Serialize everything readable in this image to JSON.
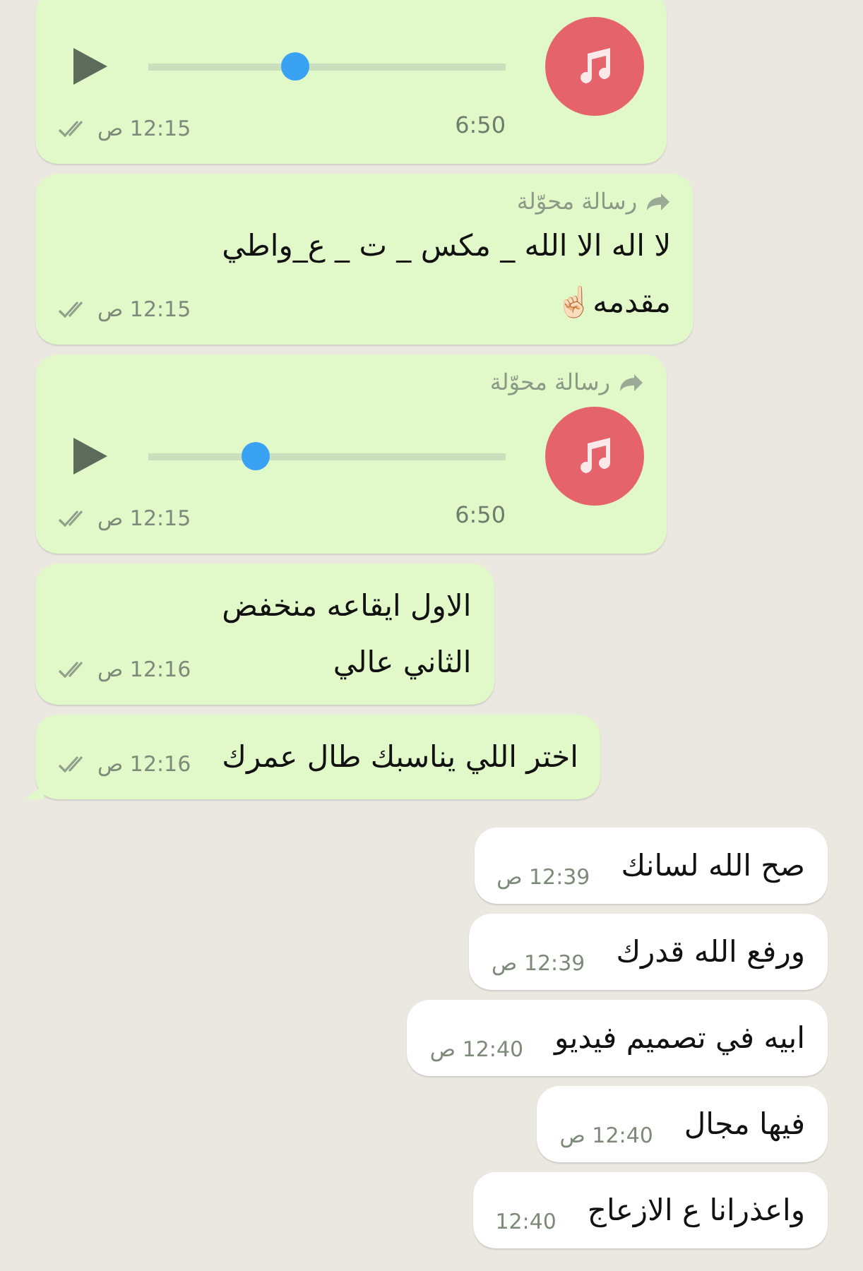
{
  "messages": [
    {
      "outgoing": true,
      "kind": "audio",
      "level": 0.41,
      "duration": "6:50",
      "time": "12:15 ص",
      "read": false,
      "tail": false
    },
    {
      "outgoing": true,
      "kind": "text",
      "forwarded_label": "رسالة محوّلة",
      "text": "لا اله الا الله _ مكس _ ت _ ع_واطي\nمقدمه☝🏻",
      "time": "12:15 ص",
      "read": false,
      "tail": false
    },
    {
      "outgoing": true,
      "kind": "audio",
      "forwarded_label": "رسالة محوّلة",
      "level": 0.3,
      "duration": "6:50",
      "time": "12:15 ص",
      "read": false,
      "tail": false
    },
    {
      "outgoing": true,
      "kind": "text",
      "text": "الاول ايقاعه منخفض\nالثاني عالي",
      "time": "12:16 ص",
      "read": false,
      "tail": false
    },
    {
      "outgoing": true,
      "kind": "text",
      "text": "اختر اللي يناسبك طال عمرك",
      "time": "12:16 ص",
      "read": false,
      "tail": true
    },
    {
      "outgoing": false,
      "kind": "text",
      "text": "صح الله لسانك",
      "time": "12:39 ص",
      "tail": false
    },
    {
      "outgoing": false,
      "kind": "text",
      "text": "ورفع الله قدرك",
      "time": "12:39 ص",
      "tail": false
    },
    {
      "outgoing": false,
      "kind": "text",
      "text": "ابيه في تصميم فيديو",
      "time": "12:40 ص",
      "tail": false
    },
    {
      "outgoing": false,
      "kind": "text",
      "text": "فيها مجال",
      "time": "12:40 ص",
      "tail": false
    },
    {
      "outgoing": false,
      "kind": "text",
      "text": "واعذرانا ع الازعاج",
      "time": "12:40",
      "tail": false
    }
  ]
}
